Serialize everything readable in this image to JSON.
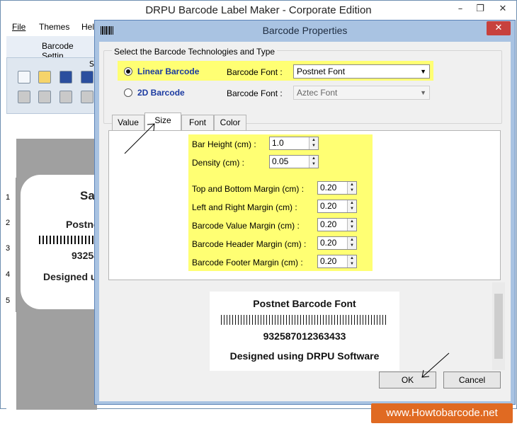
{
  "main_window": {
    "title": "DRPU Barcode Label Maker - Corporate Edition",
    "minimize_label": "–",
    "maximize_label": "❐",
    "close_label": "✕"
  },
  "menu": {
    "file": "File",
    "themes": "Themes",
    "help": "Hel"
  },
  "ribbon": {
    "tab_label": "Barcode Settin",
    "group_label": "S"
  },
  "ruler": {
    "marks": [
      "1",
      "2",
      "3",
      "4",
      "5"
    ]
  },
  "label_preview": {
    "line1": "Sa",
    "line2": "Postnet",
    "line3": "93258",
    "line4": "Designed u"
  },
  "dialog": {
    "title": "Barcode Properties",
    "close_label": "✕",
    "group_title": "Select the Barcode Technologies and Type",
    "linear": {
      "label": "Linear Barcode",
      "font_label": "Barcode Font :",
      "font_value": "Postnet Font",
      "selected": true
    },
    "twod": {
      "label": "2D Barcode",
      "font_label": "Barcode Font :",
      "font_value": "Aztec Font",
      "selected": false
    },
    "tabs": [
      "Value",
      "Size",
      "Font",
      "Color"
    ],
    "active_tab": "Size",
    "size_fields": {
      "bar_height": {
        "label": "Bar Height (cm) :",
        "value": "1.0"
      },
      "density": {
        "label": "Density (cm) :",
        "value": "0.05"
      },
      "top_bottom_margin": {
        "label": "Top and Bottom Margin (cm) :",
        "value": "0.20"
      },
      "left_right_margin": {
        "label": "Left and Right Margin (cm) :",
        "value": "0.20"
      },
      "value_margin": {
        "label": "Barcode Value Margin (cm) :",
        "value": "0.20"
      },
      "header_margin": {
        "label": "Barcode Header Margin (cm) :",
        "value": "0.20"
      },
      "footer_margin": {
        "label": "Barcode Footer Margin (cm) :",
        "value": "0.20"
      }
    },
    "preview": {
      "header": "Postnet Barcode Font",
      "value": "932587012363433",
      "footer": "Designed using DRPU Software"
    },
    "ok_label": "OK",
    "cancel_label": "Cancel"
  },
  "watermark": "www.Howtobarcode.net"
}
